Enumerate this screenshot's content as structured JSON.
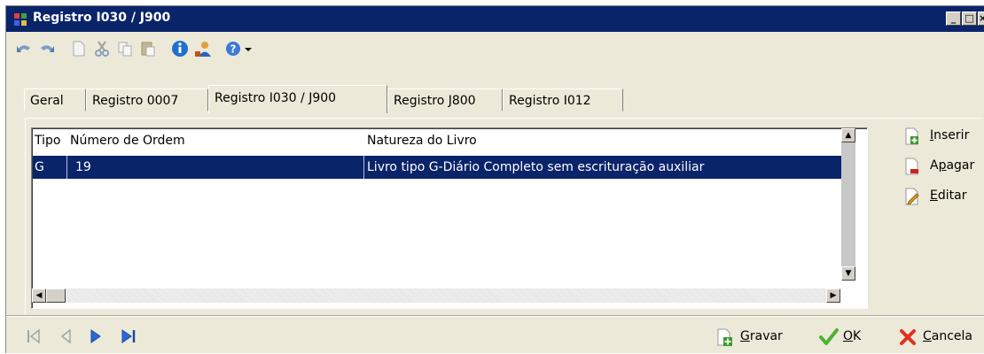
{
  "window": {
    "title": "Registro I030 / J900"
  },
  "tabs": [
    {
      "label": "Geral"
    },
    {
      "label": "Registro 0007"
    },
    {
      "label": "Registro I030 / J900",
      "active": true
    },
    {
      "label": "Registro J800"
    },
    {
      "label": "Registro I012"
    }
  ],
  "grid": {
    "columns": [
      "Tipo",
      "Número de Ordem",
      "Natureza do Livro"
    ],
    "rows": [
      {
        "tipo": "G",
        "numero": "19",
        "natureza": "Livro tipo G-Diário Completo sem escrituração auxiliar"
      }
    ]
  },
  "side_actions": {
    "insert": {
      "pre": "",
      "key": "I",
      "post": "nserir"
    },
    "delete": {
      "pre": "A",
      "key": "p",
      "post": "agar"
    },
    "edit": {
      "pre": "",
      "key": "E",
      "post": "ditar"
    }
  },
  "bottom_actions": {
    "save": {
      "pre": "",
      "key": "G",
      "post": "ravar"
    },
    "ok": {
      "pre": "",
      "key": "O",
      "post": "K"
    },
    "cancel": {
      "pre": "",
      "key": "C",
      "post": "ancela"
    }
  },
  "colors": {
    "titlebar": "#0a246a",
    "selection": "#0a246a",
    "face": "#ece9d8"
  }
}
